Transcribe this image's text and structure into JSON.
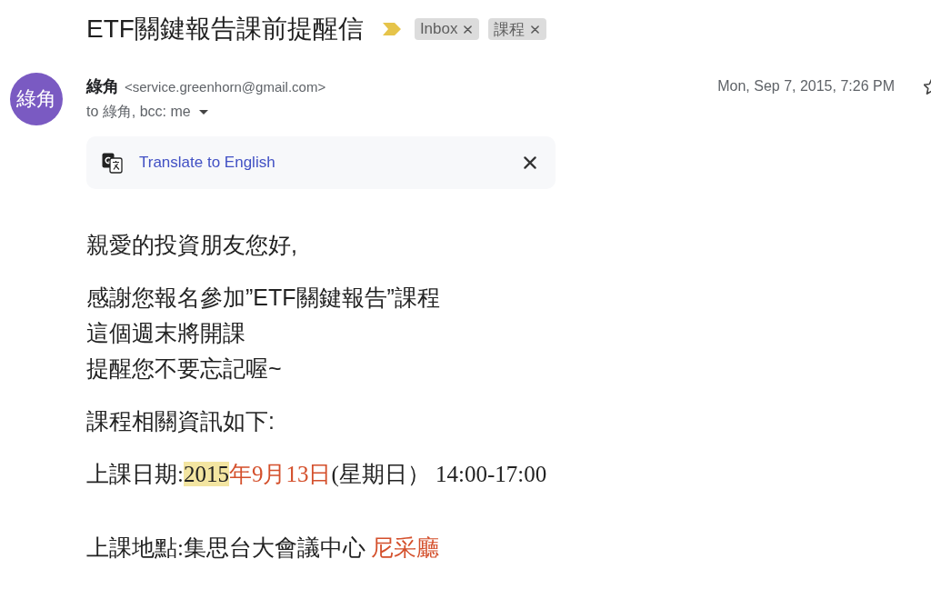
{
  "subject": {
    "title": "ETF關鍵報告課前提醒信",
    "important": true,
    "labels": [
      {
        "text": "Inbox"
      },
      {
        "text": "課程"
      }
    ]
  },
  "message": {
    "avatar": "綠角",
    "sender_name": "綠角",
    "sender_email": "<service.greenhorn@gmail.com>",
    "recipients": "to 綠角, bcc: me",
    "date": "Mon, Sep 7, 2015, 7:26 PM",
    "starred": false
  },
  "translate_bar": {
    "label": "Translate to English"
  },
  "body": {
    "paragraphs": [
      {
        "kind": "text",
        "lines": [
          "親愛的投資朋友您好,"
        ]
      },
      {
        "kind": "text",
        "lines": [
          "感謝您報名參加”ETF關鍵報告”課程",
          "這個週末將開課",
          "提醒您不要忘記喔~"
        ]
      },
      {
        "kind": "text",
        "lines": [
          "課程相關資訊如下:"
        ]
      },
      {
        "kind": "detail",
        "segments": [
          {
            "kind": "plain",
            "text": "上課日期:"
          },
          {
            "kind": "highlight",
            "text": "2015"
          },
          {
            "kind": "accent",
            "text": "年9月13日"
          },
          {
            "kind": "plain",
            "text": "(星期日） 14:00-17:00"
          }
        ]
      },
      {
        "kind": "detail",
        "segments": [
          {
            "kind": "plain",
            "text": "上課地點:集思台大會議中心 "
          },
          {
            "kind": "accent",
            "text": "尼采廳"
          }
        ]
      }
    ]
  }
}
